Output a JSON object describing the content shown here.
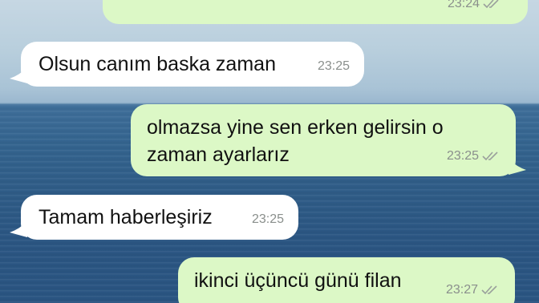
{
  "messages": [
    {
      "direction": "out",
      "text": "",
      "time": "23:24",
      "status": "read"
    },
    {
      "direction": "in",
      "text": "Olsun canım baska zaman",
      "time": "23:25"
    },
    {
      "direction": "out",
      "line1": "olmazsa yine sen erken gelirsin o",
      "line2": "zaman ayarlarız",
      "time": "23:25",
      "status": "read"
    },
    {
      "direction": "in",
      "text": "Tamam haberleşiriz",
      "time": "23:25"
    },
    {
      "direction": "out",
      "text": "ikinci üçüncü günü filan",
      "time": "23:27",
      "status": "read"
    }
  ],
  "colors": {
    "incoming_bubble": "#ffffff",
    "outgoing_bubble": "#dcf8c6",
    "timestamp": "#8a8f8c",
    "read_ticks": "#9aa09c"
  },
  "icons": {
    "read_receipt": "double-check-icon"
  }
}
